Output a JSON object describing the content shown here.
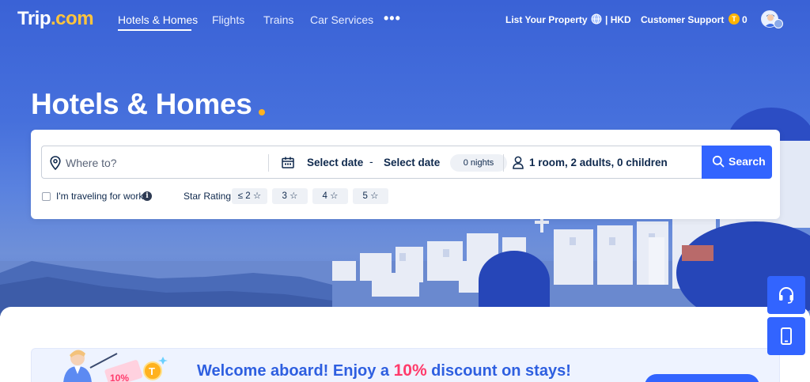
{
  "brand": {
    "logo_text": "Trip",
    "logo_suffix": ".com"
  },
  "nav": {
    "items": [
      {
        "label": "Hotels & Homes",
        "active": true
      },
      {
        "label": "Flights",
        "active": false
      },
      {
        "label": "Trains",
        "active": false
      },
      {
        "label": "Car Services",
        "active": false
      }
    ],
    "more_icon": "more-dots-icon",
    "more_label": "•••"
  },
  "header_right": {
    "list_property": "List Your Property",
    "currency": "| HKD",
    "customer_support": "Customer Support",
    "coins": "0",
    "coin_symbol": "T"
  },
  "hero": {
    "title": "Hotels & Homes"
  },
  "search": {
    "where_placeholder": "Where to?",
    "checkin": "Select date",
    "date_separator": "-",
    "checkout": "Select date",
    "nights": "0 nights",
    "guests": "1 room, 2 adults, 0 children",
    "button_label": "Search"
  },
  "options": {
    "work_travel_label": "I'm traveling for work",
    "info_glyph": "i",
    "star_rating_label": "Star Rating",
    "star_chips": [
      "≤ 2 ☆",
      "3 ☆",
      "4 ☆",
      "5 ☆"
    ]
  },
  "promo": {
    "text_before": "Welcome aboard! Enjoy a ",
    "highlight": "10%",
    "text_after": " discount on stays!",
    "coin_symbol": "T",
    "badge_text": "10%"
  },
  "colors": {
    "brand_blue": "#3264ff",
    "hero_blue": "#4670dc",
    "accent_yellow": "#ffb21e",
    "promo_pink": "#ff3b6b",
    "text_dark": "#0f294d"
  }
}
